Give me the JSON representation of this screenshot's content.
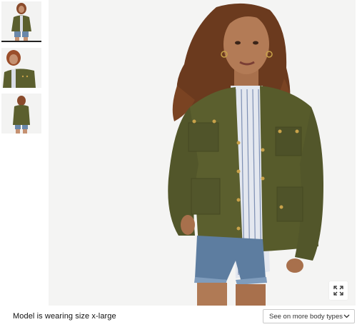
{
  "thumbnails": [
    {
      "label": "Front view",
      "active": true
    },
    {
      "label": "Close-up view",
      "active": false
    },
    {
      "label": "Back view",
      "active": false
    }
  ],
  "main_image": {
    "alt": "Model wearing olive field jacket with striped shirt and denim shorts"
  },
  "expand_icon": "expand-icon",
  "caption": "Model is wearing size x-large",
  "body_types_select": {
    "selected": "See on more body types",
    "icon": "chevron-down-icon"
  },
  "colors": {
    "jacket": "#5b5f2e",
    "background": "#f4f4f3",
    "denim": "#5d7da0",
    "hair": "#6b3a1e",
    "skin": "#b07a55"
  }
}
